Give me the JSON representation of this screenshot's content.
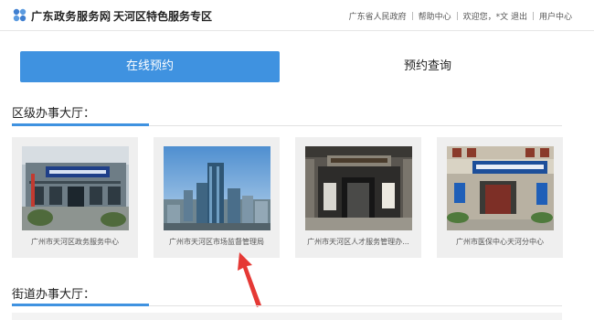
{
  "header": {
    "site_title": "广东政务服务网",
    "zone_title": "天河区特色服务专区",
    "links": [
      "广东省人民政府",
      "帮助中心",
      "欢迎您，*文 退出",
      "用户中心"
    ]
  },
  "tabs": {
    "online_booking": "在线预约",
    "booking_query": "预约查询"
  },
  "sections": {
    "district": "区级办事大厅：",
    "street": "街道办事大厅："
  },
  "halls": [
    {
      "caption": "广州市天河区政务服务中心"
    },
    {
      "caption": "广州市天河区市场监督管理局"
    },
    {
      "caption": "广州市天河区人才服务管理办..."
    },
    {
      "caption": "广州市医保中心天河分中心"
    }
  ],
  "colors": {
    "accent": "#3f92e0"
  },
  "icons": {
    "logo": "gd-logo-icon",
    "annotation": "red-arrow-icon"
  }
}
